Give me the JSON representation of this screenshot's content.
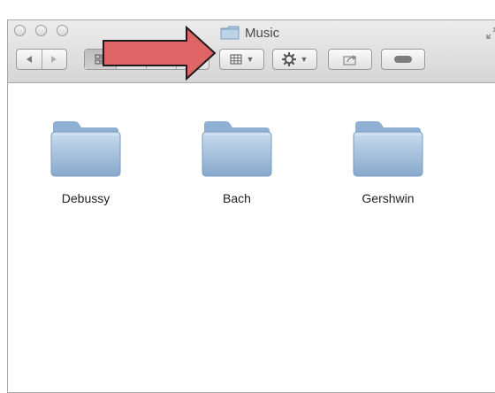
{
  "window": {
    "title": "Music",
    "title_icon": "folder-icon"
  },
  "toolbar": {
    "back_icon": "triangle-left",
    "forward_icon": "triangle-right",
    "view_modes": [
      "icon-view",
      "list-view",
      "column-view",
      "cover-flow-view"
    ],
    "active_view": "icon-view",
    "arrange_icon": "grid-icon",
    "action_icon": "gear-icon",
    "share_icon": "share-icon",
    "tag_icon": "tag-pill-icon",
    "overflow_glyph": "»"
  },
  "files": {
    "items": [
      {
        "name": "Debussy",
        "kind": "folder"
      },
      {
        "name": "Bach",
        "kind": "folder"
      },
      {
        "name": "Gershwin",
        "kind": "folder"
      }
    ]
  },
  "colors": {
    "folder_light": "#c9dcee",
    "folder_mid": "#9dbcdb",
    "folder_dark": "#86a8cb",
    "arrow_fill": "#de6466",
    "arrow_stroke": "#1c1c1c"
  }
}
